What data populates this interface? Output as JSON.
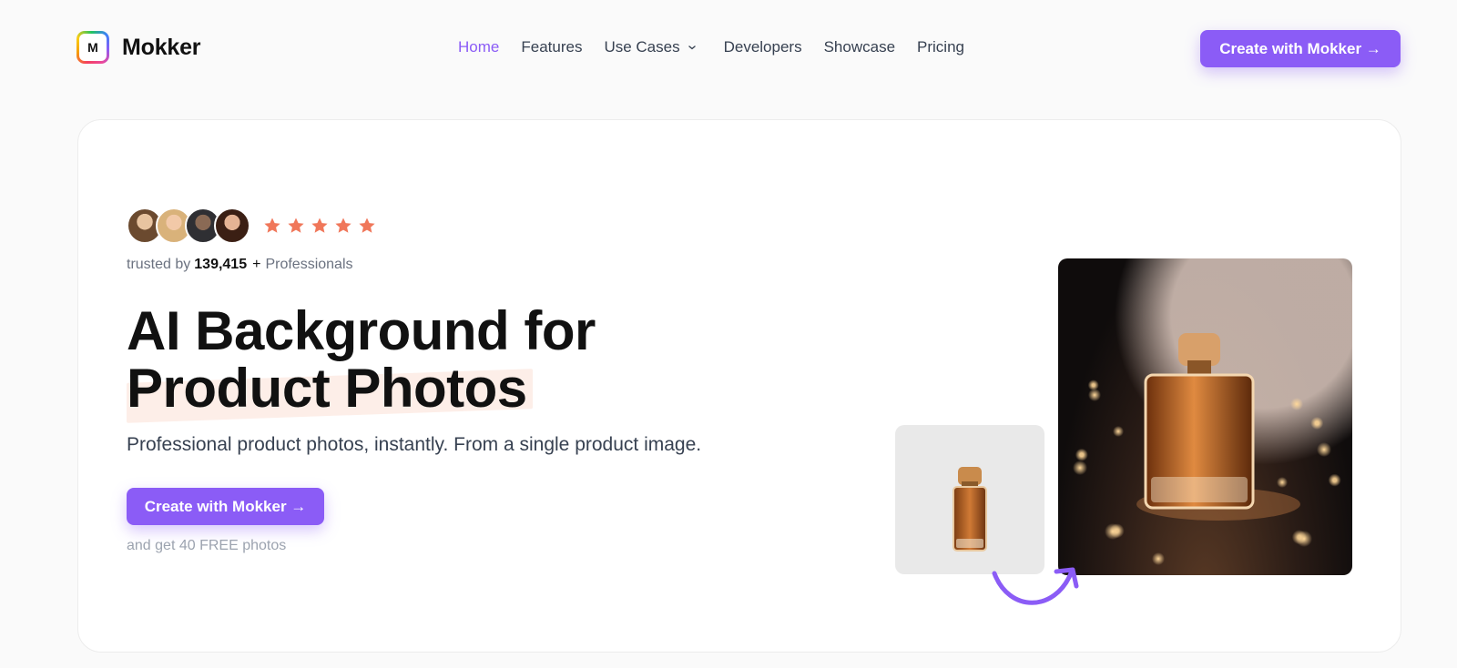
{
  "brand": {
    "name": "Mokker",
    "mark_letter": "M"
  },
  "nav": {
    "items": [
      {
        "label": "Home",
        "active": true
      },
      {
        "label": "Features",
        "active": false
      },
      {
        "label": "Use Cases",
        "active": false,
        "has_dropdown": true
      },
      {
        "label": "Developers",
        "active": false
      },
      {
        "label": "Showcase",
        "active": false
      },
      {
        "label": "Pricing",
        "active": false
      }
    ],
    "cta_label": "Create with Mokker →"
  },
  "hero": {
    "rating_stars": 5,
    "trusted_prefix": "trusted by",
    "trusted_count": "139,415",
    "trusted_plus": "+",
    "trusted_suffix": "Professionals",
    "headline_line1": "AI Background for",
    "headline_line2": "Product Photos",
    "subtitle": "Professional product photos, instantly. From a single product image.",
    "cta_label": "Create with Mokker →",
    "free_note": "and get 40 FREE photos"
  },
  "colors": {
    "accent": "#8b5cf6",
    "star": "#f0775a",
    "highlight": "#fdeee8"
  },
  "icons": {
    "logo": "mokker-logo-icon",
    "dropdown": "chevron-down-icon",
    "star": "star-icon",
    "arrow": "curved-arrow-icon"
  }
}
